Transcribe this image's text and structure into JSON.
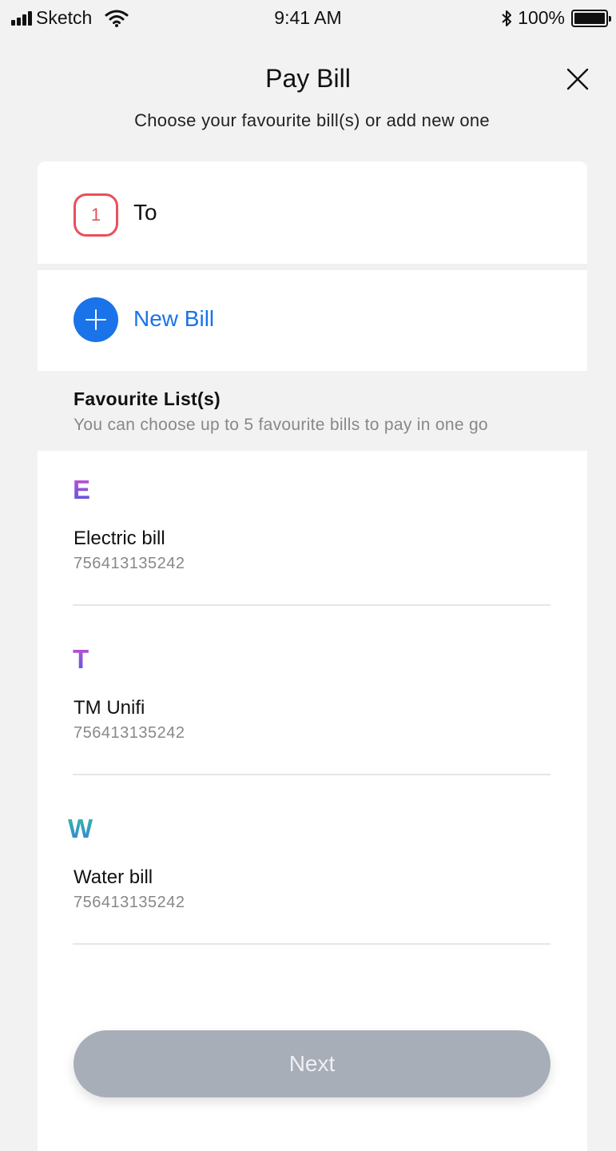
{
  "status_bar": {
    "carrier": "Sketch",
    "time": "9:41 AM",
    "battery_percent": "100%",
    "icons": [
      "signal-icon",
      "wifi-icon",
      "bluetooth-icon",
      "battery-icon"
    ]
  },
  "header": {
    "title": "Pay Bill",
    "subtitle": "Choose your favourite bill(s) or add new one",
    "close_icon": "close-icon"
  },
  "to_section": {
    "step_number": "1",
    "label": "To",
    "badge_color": "#e8505b"
  },
  "new_bill": {
    "label": "New Bill",
    "icon": "plus-icon",
    "accent_color": "#1a73e8"
  },
  "favourites": {
    "title": "Favourite List(s)",
    "subtitle": "You can choose up to 5 favourite bills to pay in one go",
    "items": [
      {
        "letter": "E",
        "name": "Electric bill",
        "number": "756413135242",
        "letter_colors": [
          "#d04ed6",
          "#4a5bd8"
        ]
      },
      {
        "letter": "T",
        "name": "TM Unifi",
        "number": "756413135242",
        "letter_colors": [
          "#c84fd0",
          "#4f5ae0"
        ]
      },
      {
        "letter": "W",
        "name": "Water bill",
        "number": "756413135242",
        "letter_colors": [
          "#2fc1a0",
          "#3a7be0"
        ]
      }
    ]
  },
  "footer": {
    "next_label": "Next",
    "next_color": "#a7aeb8"
  }
}
